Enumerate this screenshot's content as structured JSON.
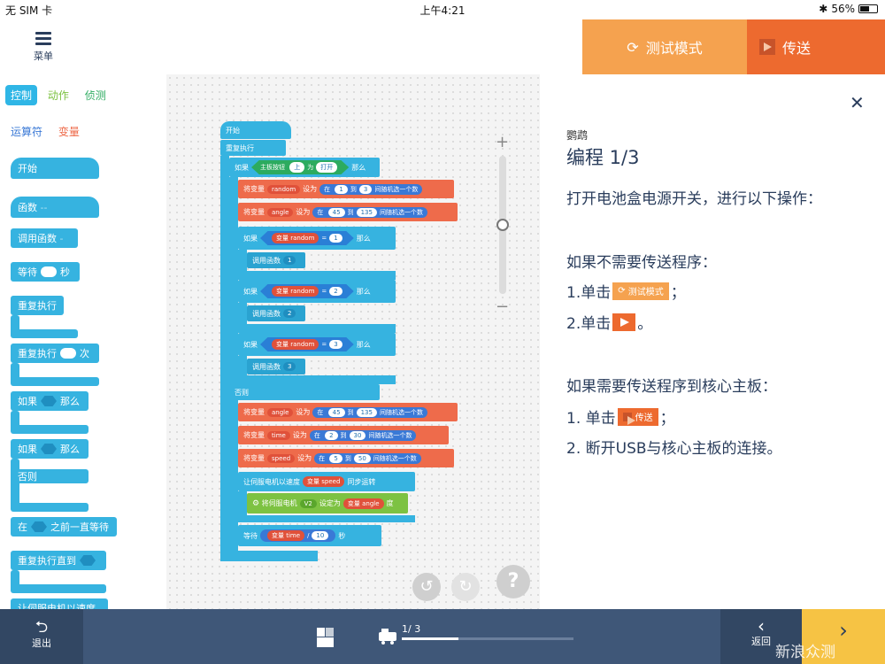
{
  "status_bar": {
    "carrier": "无 SIM 卡",
    "time": "上午4:21",
    "battery": "56%",
    "battery_level": 0.56
  },
  "header": {
    "menu_label": "菜单",
    "test_mode_label": "测试模式",
    "send_label": "传送"
  },
  "categories": [
    "控制",
    "动作",
    "侦测",
    "运算符",
    "变量"
  ],
  "category_colors": {
    "控制": "#ffffff",
    "动作": "#7dc242",
    "侦测": "#2cab5f",
    "运算符": "#3a79d6",
    "变量": "#ee6b4b"
  },
  "palette": {
    "start": "开始",
    "function": "函数",
    "call_function": "调用函数",
    "wait": "等待",
    "seconds": "秒",
    "repeat_forever": "重复执行",
    "repeat": "重复执行",
    "times": "次",
    "if": "如果",
    "then": "那么",
    "else": "否则",
    "at": "在",
    "wait_until": "之前一直等待",
    "repeat_until": "重复执行直到",
    "servo_speed": "让伺服电机以速度"
  },
  "script": {
    "start": "开始",
    "forever": "重复执行",
    "if": "如果",
    "then": "那么",
    "button": "主板按钮",
    "button_pos": "上",
    "is": "为",
    "pressed": "打开",
    "set_var": "将变量",
    "set_to": "设为",
    "at": "在",
    "to": "到",
    "random_pick": "间随机选一个数",
    "var": "变量",
    "call_function": "调用函数",
    "else": "否则",
    "var_random": "random",
    "var_angle": "angle",
    "var_time": "time",
    "var_speed": "speed",
    "r1_min": "1",
    "r1_max": "3",
    "a1_min": "45",
    "a1_max": "135",
    "cmp1": "1",
    "cmp2": "2",
    "cmp3": "3",
    "fn1": "1",
    "fn2": "2",
    "fn3": "3",
    "eq": "=",
    "a2_min": "45",
    "a2_max": "135",
    "t_min": "2",
    "t_max": "30",
    "s_min": "5",
    "s_max": "50",
    "servo_sync": "让伺服电机以速度",
    "sync_run": "同步运转",
    "set_servo": "将伺服电机",
    "servo_id": "V2",
    "set_angle": "设定为",
    "degree": "度",
    "wait": "等待",
    "div": "/",
    "div_val": "10",
    "sec": "秒"
  },
  "panel": {
    "close": "✕",
    "subtitle": "鹦鹉",
    "title": "编程 1/3",
    "intro": "打开电池盒电源开关，进行以下操作：",
    "no_send_header": "如果不需要传送程序：",
    "step1_prefix": "1.单击",
    "step1_chip": "测试模式",
    "step1_suffix": "；",
    "step2_prefix": "2.单击",
    "step2_suffix": "。",
    "send_header": "如果需要传送程序到核心主板：",
    "step3_prefix": "1. 单击",
    "step3_chip": "传送",
    "step3_suffix": "；",
    "step4": "2. 断开USB与核心主板的连接。"
  },
  "bottom_bar": {
    "exit_label": "退出",
    "step": "1/ 3",
    "progress": 0.33,
    "prev_label": "返回"
  },
  "watermark": "新浪众测",
  "colors": {
    "control": "#36b3e0",
    "variable": "#ee6b4b",
    "motion": "#7dc242",
    "test_btn": "#f5a24f",
    "send_btn": "#ed6a2f",
    "bottom": "#3f5778",
    "next": "#f6c344"
  }
}
